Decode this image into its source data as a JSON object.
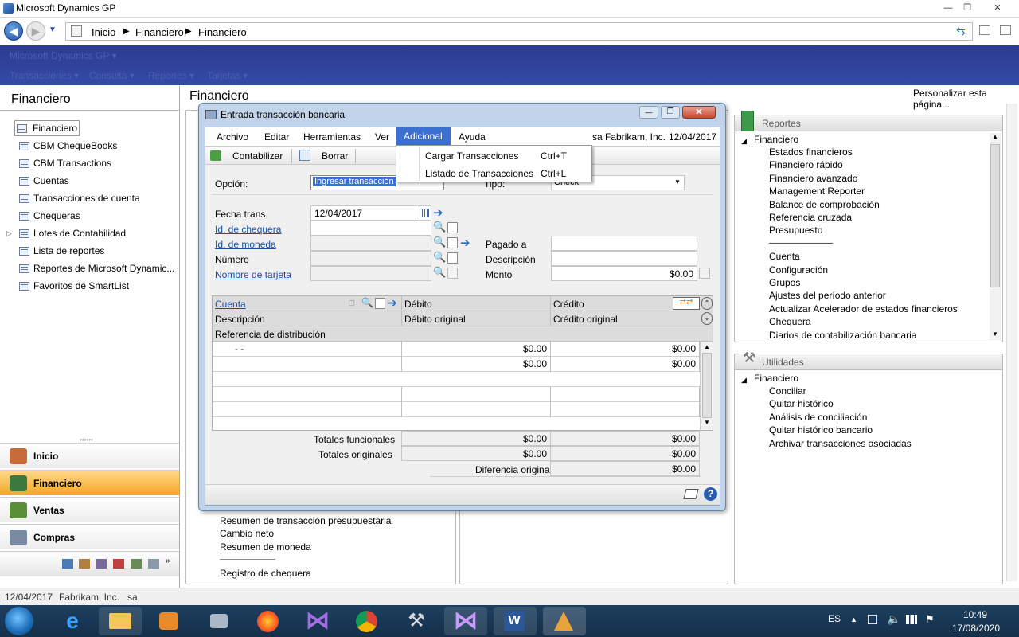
{
  "window": {
    "title": "Microsoft Dynamics GP",
    "min": "—",
    "max": "❐",
    "close": "✕"
  },
  "breadcrumb": [
    "Inicio",
    "Financiero",
    "Financiero"
  ],
  "ribbon": {
    "app": "Microsoft Dynamics GP",
    "menus": [
      "Transacciones",
      "Consulta",
      "Reportes",
      "Tarjetas"
    ]
  },
  "leftnav": {
    "title": "Financiero",
    "items": [
      "Financiero",
      "CBM ChequeBooks",
      "CBM Transactions",
      "Cuentas",
      "Transacciones de cuenta",
      "Chequeras",
      "Lotes de Contabilidad",
      "Lista de reportes",
      "Reportes de Microsoft Dynamic...",
      "Favoritos de SmartList"
    ],
    "buttons": [
      "Inicio",
      "Financiero",
      "Ventas",
      "Compras"
    ]
  },
  "main": {
    "title": "Financiero",
    "personalizar": "Personalizar esta página...",
    "left_bottom_list": [
      "Resumen de transacción presupuestaria",
      "Cambio neto",
      "Resumen de moneda",
      "———————",
      "Registro de chequera"
    ]
  },
  "reportes": {
    "title": "Reportes",
    "root": "Financiero",
    "items": [
      "Estados financieros",
      "Financiero rápido",
      "Financiero avanzado",
      "Management Reporter",
      "Balance de comprobación",
      "Referencia cruzada",
      "Presupuesto",
      "————————",
      "Cuenta",
      "Configuración",
      "Grupos",
      "Ajustes del período anterior",
      "Actualizar Acelerador de estados financieros",
      "Chequera",
      "Diarios de contabilización bancaria"
    ]
  },
  "utilidades": {
    "title": "Utilidades",
    "root": "Financiero",
    "items": [
      "Conciliar",
      "Quitar histórico",
      "Análisis de conciliación",
      "Quitar histórico bancario",
      "Archivar transacciones asociadas"
    ]
  },
  "dialog": {
    "title": "Entrada transacción bancaria",
    "menu": [
      "Archivo",
      "Editar",
      "Herramientas",
      "Ver",
      "Adicional",
      "Ayuda"
    ],
    "user": "sa",
    "company": "Fabrikam, Inc.",
    "date": "12/04/2017",
    "toolbar": {
      "post": "Contabilizar",
      "delete": "Borrar"
    },
    "opcion_label": "Opción:",
    "opcion_value": "Ingresar transacción",
    "tipo_label": "Tipo:",
    "tipo_value": "Check",
    "fecha_label": "Fecha trans.",
    "fecha_value": "12/04/2017",
    "chequera_label": "Id. de chequera",
    "moneda_label": "Id. de moneda",
    "numero_label": "Número",
    "tarjeta_label": "Nombre de tarjeta",
    "pagado_label": "Pagado a",
    "descripcion_label": "Descripción",
    "monto_label": "Monto",
    "monto_value": "$0.00",
    "grid": {
      "h1": [
        "Cuenta",
        "Débito",
        "Crédito"
      ],
      "h2": [
        "Descripción",
        "Débito original",
        "Crédito original"
      ],
      "h3": "Referencia de distribución",
      "row1": {
        "cuenta": "-      -",
        "debito": "$0.00",
        "credito": "$0.00"
      },
      "row2": {
        "debito": "$0.00",
        "credito": "$0.00"
      }
    },
    "totales_funcionales": {
      "label": "Totales funcionales",
      "debito": "$0.00",
      "credito": "$0.00"
    },
    "totales_originales": {
      "label": "Totales originales",
      "debito": "$0.00",
      "credito": "$0.00"
    },
    "diferencia": {
      "label": "Diferencia original",
      "value": "$0.00"
    }
  },
  "dropdown": {
    "items": [
      {
        "label": "Cargar Transacciones",
        "shortcut": "Ctrl+T"
      },
      {
        "label": "Listado de Transacciones",
        "shortcut": "Ctrl+L"
      }
    ]
  },
  "status": {
    "date": "12/04/2017",
    "company": "Fabrikam, Inc.",
    "user": "sa"
  },
  "taskbar": {
    "lang": "ES",
    "time": "10:49",
    "date": "17/08/2020"
  },
  "colors": {
    "ribbon": "#2b3d92",
    "selected_menu": "#3b6fd0",
    "nav_selected": "#f5a623"
  }
}
